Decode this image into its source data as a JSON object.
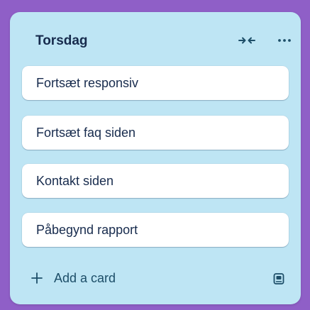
{
  "list": {
    "title": "Torsdag",
    "cards": [
      {
        "label": "Fortsæt responsiv"
      },
      {
        "label": "Fortsæt faq siden"
      },
      {
        "label": "Kontakt siden"
      },
      {
        "label": "Påbegynd rapport"
      }
    ],
    "add_card_label": "Add a card",
    "icons": {
      "collapse": "collapse-icon",
      "more": "more-icon",
      "add": "plus-icon",
      "template": "card-template-icon"
    }
  },
  "colors": {
    "board_background": "#8f5fc7",
    "list_background": "#bee5f4",
    "card_background": "#ffffff",
    "text": "#172b4d",
    "accent_text": "#1d4e68"
  }
}
